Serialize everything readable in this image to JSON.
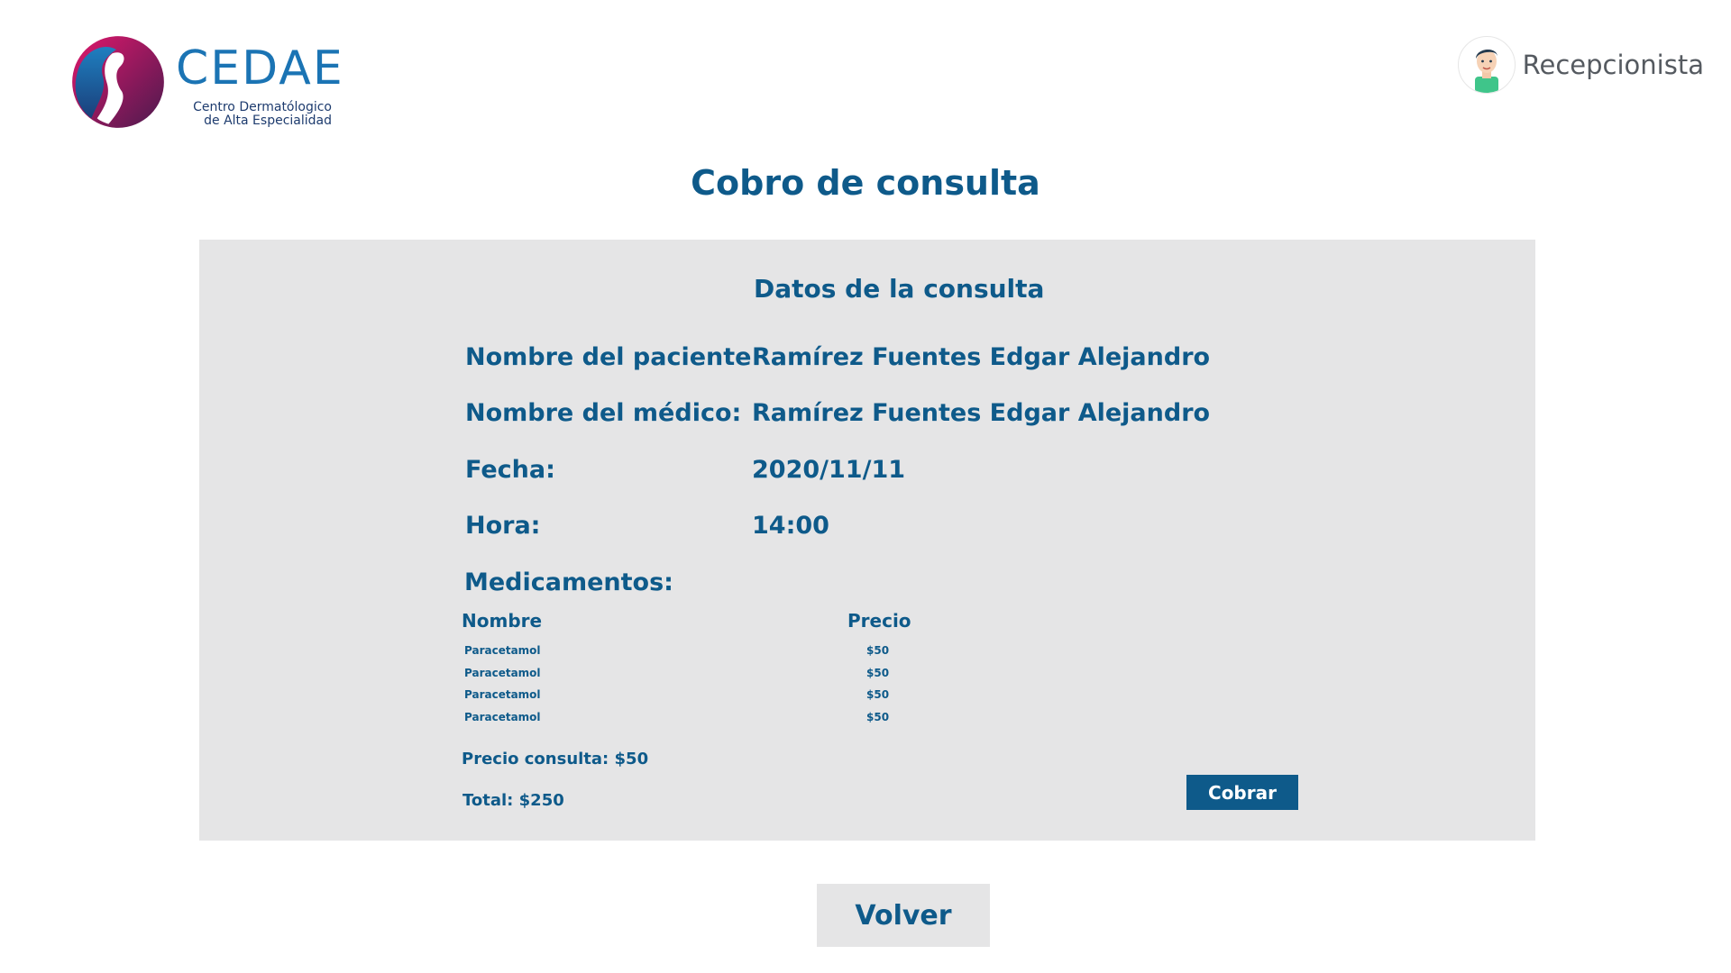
{
  "brand": {
    "title": "CEDAE",
    "subtitle_line1": "Centro Dermatólogico",
    "subtitle_line2": "de Alta Especialidad"
  },
  "user": {
    "role": "Recepcionista",
    "avatar_icon": "user-avatar-icon"
  },
  "page": {
    "title": "Cobro de consulta"
  },
  "consulta": {
    "section_title": "Datos de la consulta",
    "rows": [
      {
        "label": "Nombre del paciente:",
        "value": "Ramírez Fuentes Edgar Alejandro"
      },
      {
        "label": "Nombre del médico:",
        "value": "Ramírez Fuentes Edgar Alejandro"
      },
      {
        "label": "Fecha:",
        "value": "2020/11/11"
      },
      {
        "label": "Hora:",
        "value": "14:00"
      }
    ],
    "medicamentos": {
      "heading": "Medicamentos:",
      "columns": [
        "Nombre",
        "Precio"
      ],
      "items": [
        {
          "name": "Paracetamol",
          "price": "$50"
        },
        {
          "name": "Paracetamol",
          "price": "$50"
        },
        {
          "name": "Paracetamol",
          "price": "$50"
        },
        {
          "name": "Paracetamol",
          "price": "$50"
        }
      ]
    },
    "precio_consulta": "Precio consulta: $50",
    "total": "Total: $250",
    "cobrar_label": "Cobrar"
  },
  "volver_label": "Volver",
  "colors": {
    "primary": "#0e5a8a",
    "card_bg": "#e5e5e6",
    "logo_pink": "#d6196b",
    "logo_blue": "#1b74b4"
  }
}
